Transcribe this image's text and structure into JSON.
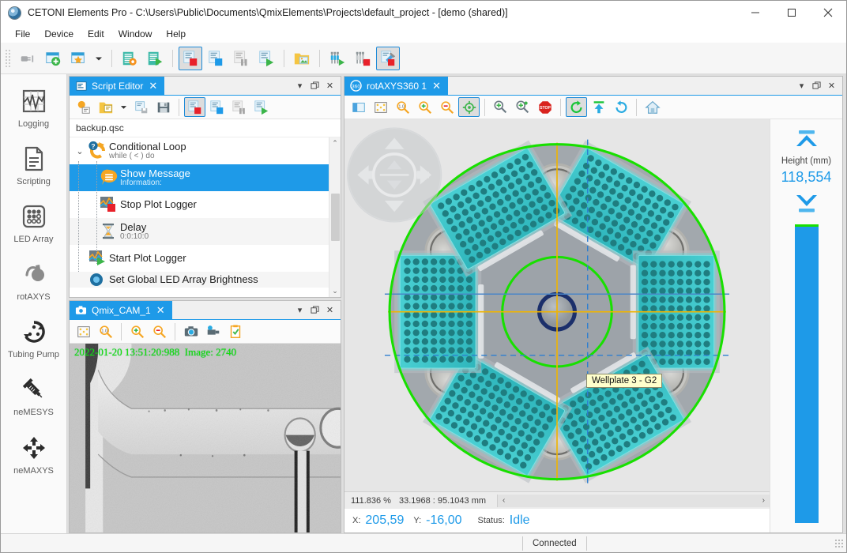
{
  "window": {
    "title": "CETONI Elements Pro - C:\\Users\\Public\\Documents\\QmixElements\\Projects\\default_project - [demo (shared)]",
    "minimize": "–",
    "maximize": "□",
    "close": "✕"
  },
  "menu": {
    "items": [
      "File",
      "Device",
      "Edit",
      "Window",
      "Help"
    ]
  },
  "main_toolbar": {
    "buttons": [
      {
        "name": "disconnect-plug-icon",
        "title": "Disconnect",
        "selected": false
      },
      {
        "name": "add-window-icon",
        "title": "New window",
        "selected": false
      },
      {
        "name": "favorite-window-icon",
        "title": "Favorites",
        "selected": false
      },
      {
        "name": "favorite-dropdown-icon",
        "title": "Favorites dropdown",
        "selected": false
      },
      {
        "name": "script-settings-icon",
        "title": "Script settings",
        "selected": false
      },
      {
        "name": "script-run-icon",
        "title": "Run script",
        "selected": false
      },
      {
        "name": "log-stop-icon",
        "title": "Stop logging",
        "selected": true
      },
      {
        "name": "log-record-icon",
        "title": "Record",
        "selected": false
      },
      {
        "name": "log-pause-icon",
        "title": "Pause",
        "selected": false
      },
      {
        "name": "log-play-icon",
        "title": "Play",
        "selected": false
      },
      {
        "name": "open-folder-image-icon",
        "title": "Open image folder",
        "selected": false
      },
      {
        "name": "syringe-start-icon",
        "title": "Start pumps",
        "selected": false
      },
      {
        "name": "syringe-stop-icon",
        "title": "Stop pumps",
        "selected": false
      },
      {
        "name": "calibration-tool-icon",
        "title": "Calibration",
        "selected": true
      }
    ]
  },
  "sidebar": {
    "items": [
      {
        "label": "Logging",
        "icon": "chart-logging-icon"
      },
      {
        "label": "Scripting",
        "icon": "document-script-icon"
      },
      {
        "label": "LED Array",
        "icon": "led-array-icon"
      },
      {
        "label": "rotAXYS",
        "icon": "rotaxys-icon"
      },
      {
        "label": "Tubing Pump",
        "icon": "tubing-pump-icon"
      },
      {
        "label": "neMESYS",
        "icon": "syringe-icon"
      },
      {
        "label": "neMAXYS",
        "icon": "axes-move-icon"
      }
    ]
  },
  "script_editor": {
    "tab_title": "Script Editor",
    "tab_close": "✕",
    "menu_caret": "▾",
    "restore": "❐",
    "close": "✕",
    "file_name": "backup.qsc",
    "toolbar": [
      {
        "name": "new-script-icon",
        "selected": false
      },
      {
        "name": "open-script-icon",
        "selected": false
      },
      {
        "name": "open-script-dropdown-icon",
        "selected": false
      },
      {
        "name": "save-script-icon",
        "selected": false
      },
      {
        "name": "save-as-script-icon",
        "selected": false
      },
      {
        "name": "script-stop-icon",
        "selected": true
      },
      {
        "name": "script-record-icon",
        "selected": false
      },
      {
        "name": "script-pause-icon",
        "selected": false
      },
      {
        "name": "script-run-icon",
        "selected": false
      }
    ],
    "rows": [
      {
        "title": "Conditional Loop",
        "subtitle": "while ( < ) do",
        "icon": "conditional-loop-icon",
        "depth": 0,
        "selected": false,
        "expander": "⌄"
      },
      {
        "title": "Show Message",
        "subtitle": "Information:",
        "icon": "show-message-icon",
        "depth": 1,
        "selected": true,
        "expander": ""
      },
      {
        "title": "Stop Plot Logger",
        "subtitle": "",
        "icon": "stop-plot-logger-icon",
        "depth": 1,
        "selected": false,
        "expander": ""
      },
      {
        "title": "Delay",
        "subtitle": "0:0:10:0",
        "icon": "delay-hourglass-icon",
        "depth": 1,
        "selected": false,
        "expander": ""
      },
      {
        "title": "Start Plot Logger",
        "subtitle": "",
        "icon": "start-plot-logger-icon",
        "depth": 0,
        "selected": false,
        "expander": ""
      },
      {
        "title": "Set Global LED Array Brightness",
        "subtitle": "",
        "icon": "led-brightness-icon",
        "depth": 0,
        "selected": false,
        "expander": ""
      }
    ],
    "scroll_up": "⌃",
    "scroll_down": "⌄"
  },
  "camera": {
    "tab_title": "Qmix_CAM_1",
    "tab_close": "✕",
    "menu_caret": "▾",
    "restore": "❐",
    "close": "✕",
    "toolbar": [
      {
        "name": "fit-view-icon"
      },
      {
        "name": "zoom-100-icon"
      },
      {
        "name": "zoom-in-icon"
      },
      {
        "name": "zoom-out-icon"
      },
      {
        "name": "snapshot-camera-icon"
      },
      {
        "name": "record-video-icon"
      },
      {
        "name": "clipboard-check-icon"
      }
    ],
    "overlay_date": "2022-01-20",
    "overlay_time": "13:51:20:988",
    "overlay_image_label": "Image: 2740"
  },
  "rotaxys": {
    "tab_title": "rotAXYS360 1",
    "tab_close": "✕",
    "menu_caret": "▾",
    "restore": "❐",
    "close": "✕",
    "toolbar": [
      {
        "name": "layout-panel-icon",
        "selected": false
      },
      {
        "name": "fit-view-icon",
        "selected": false
      },
      {
        "name": "zoom-100-icon",
        "selected": false
      },
      {
        "name": "zoom-in-icon",
        "selected": false
      },
      {
        "name": "zoom-out-icon",
        "selected": false
      },
      {
        "name": "crosshair-target-icon",
        "selected": true
      },
      {
        "name": "add-position-icon",
        "selected": false
      },
      {
        "name": "edit-position-icon",
        "selected": false
      },
      {
        "name": "emergency-stop-icon",
        "selected": false
      },
      {
        "name": "rotate-cw-icon",
        "selected": true
      },
      {
        "name": "move-up-icon",
        "selected": false
      },
      {
        "name": "rotate-reset-icon",
        "selected": false
      },
      {
        "name": "home-icon",
        "selected": false
      }
    ],
    "tooltip": "Wellplate 3 - G2",
    "zoom_percent": "111.836 %",
    "coords_mm": "33.1968 : 95.1043 mm",
    "scroll_left": "‹",
    "scroll_right": "›",
    "x_label": "X:",
    "x_value": "205,59",
    "y_label": "Y:",
    "y_value": "-16,00",
    "status_label": "Status:",
    "status_value": "Idle",
    "height_label": "Height (mm)",
    "height_value": "118,554",
    "height_up_icon": "move-top-icon",
    "height_down_icon": "move-bottom-icon"
  },
  "status_bar": {
    "connection": "Connected"
  },
  "colors": {
    "accent_blue": "#1e9ae8",
    "wellplate_teal": "#3fc7c9",
    "well_dark": "#1f7d80",
    "rotor_gray": "#9aa0a6",
    "ring_green": "#18e000",
    "guide_yellow": "#f0b400",
    "tooltip_yellow": "#ffffcc",
    "overlay_green": "#18e000"
  }
}
